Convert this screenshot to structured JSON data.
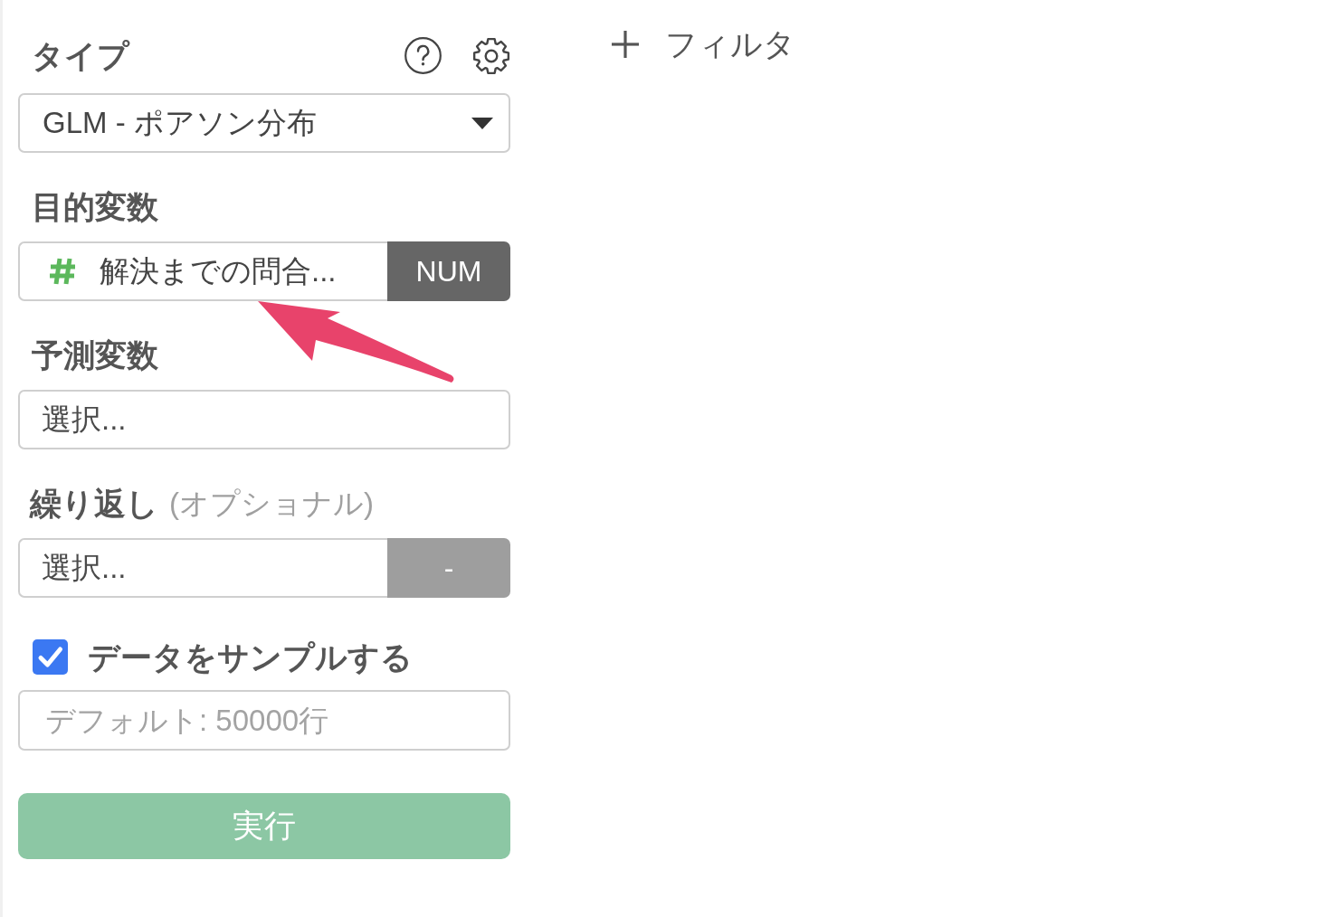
{
  "type_section": {
    "label": "タイプ",
    "value": "GLM - ポアソン分布"
  },
  "target_variable": {
    "label": "目的変数",
    "value": "解決までの問合...",
    "data_type": "NUM"
  },
  "predictor_variables": {
    "label": "予測変数",
    "placeholder": "選択..."
  },
  "repeat": {
    "label": "繰り返し",
    "note": "(オプショナル)",
    "placeholder": "選択...",
    "data_type": "-"
  },
  "sample": {
    "label": "データをサンプルする",
    "checked": true,
    "placeholder": "デフォルト: 50000行"
  },
  "run_button": {
    "label": "実行",
    "disabled": true
  },
  "filter_button": {
    "label": "フィルタ"
  },
  "annotation_arrow": true
}
